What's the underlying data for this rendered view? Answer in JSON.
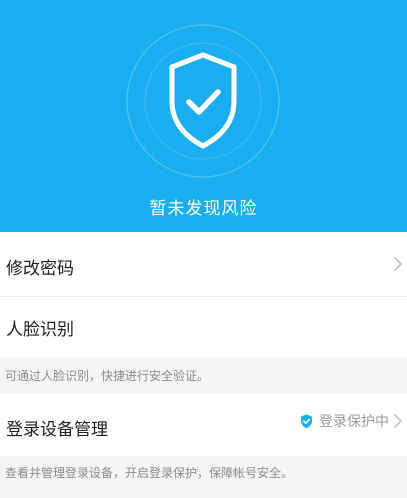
{
  "hero": {
    "status_text": "暂未发现风险",
    "background_color": "#1aaeef"
  },
  "security_items": [
    {
      "title": "修改密码",
      "icon": "chevron-right-icon"
    },
    {
      "title": "人脸识别",
      "description": "可通过人脸识别，快捷进行安全验证。"
    },
    {
      "title": "登录设备管理",
      "status_text": "登录保护中",
      "status_icon": "shield-check-icon",
      "icon": "chevron-right-icon",
      "description": "查看并管理登录设备，开启登录保护，保障帐号安全。"
    }
  ],
  "colors": {
    "accent": "#1aaeef",
    "status_icon": "#1aaeef",
    "text_primary": "#1f1f1f",
    "text_secondary": "#8c8c8c"
  }
}
